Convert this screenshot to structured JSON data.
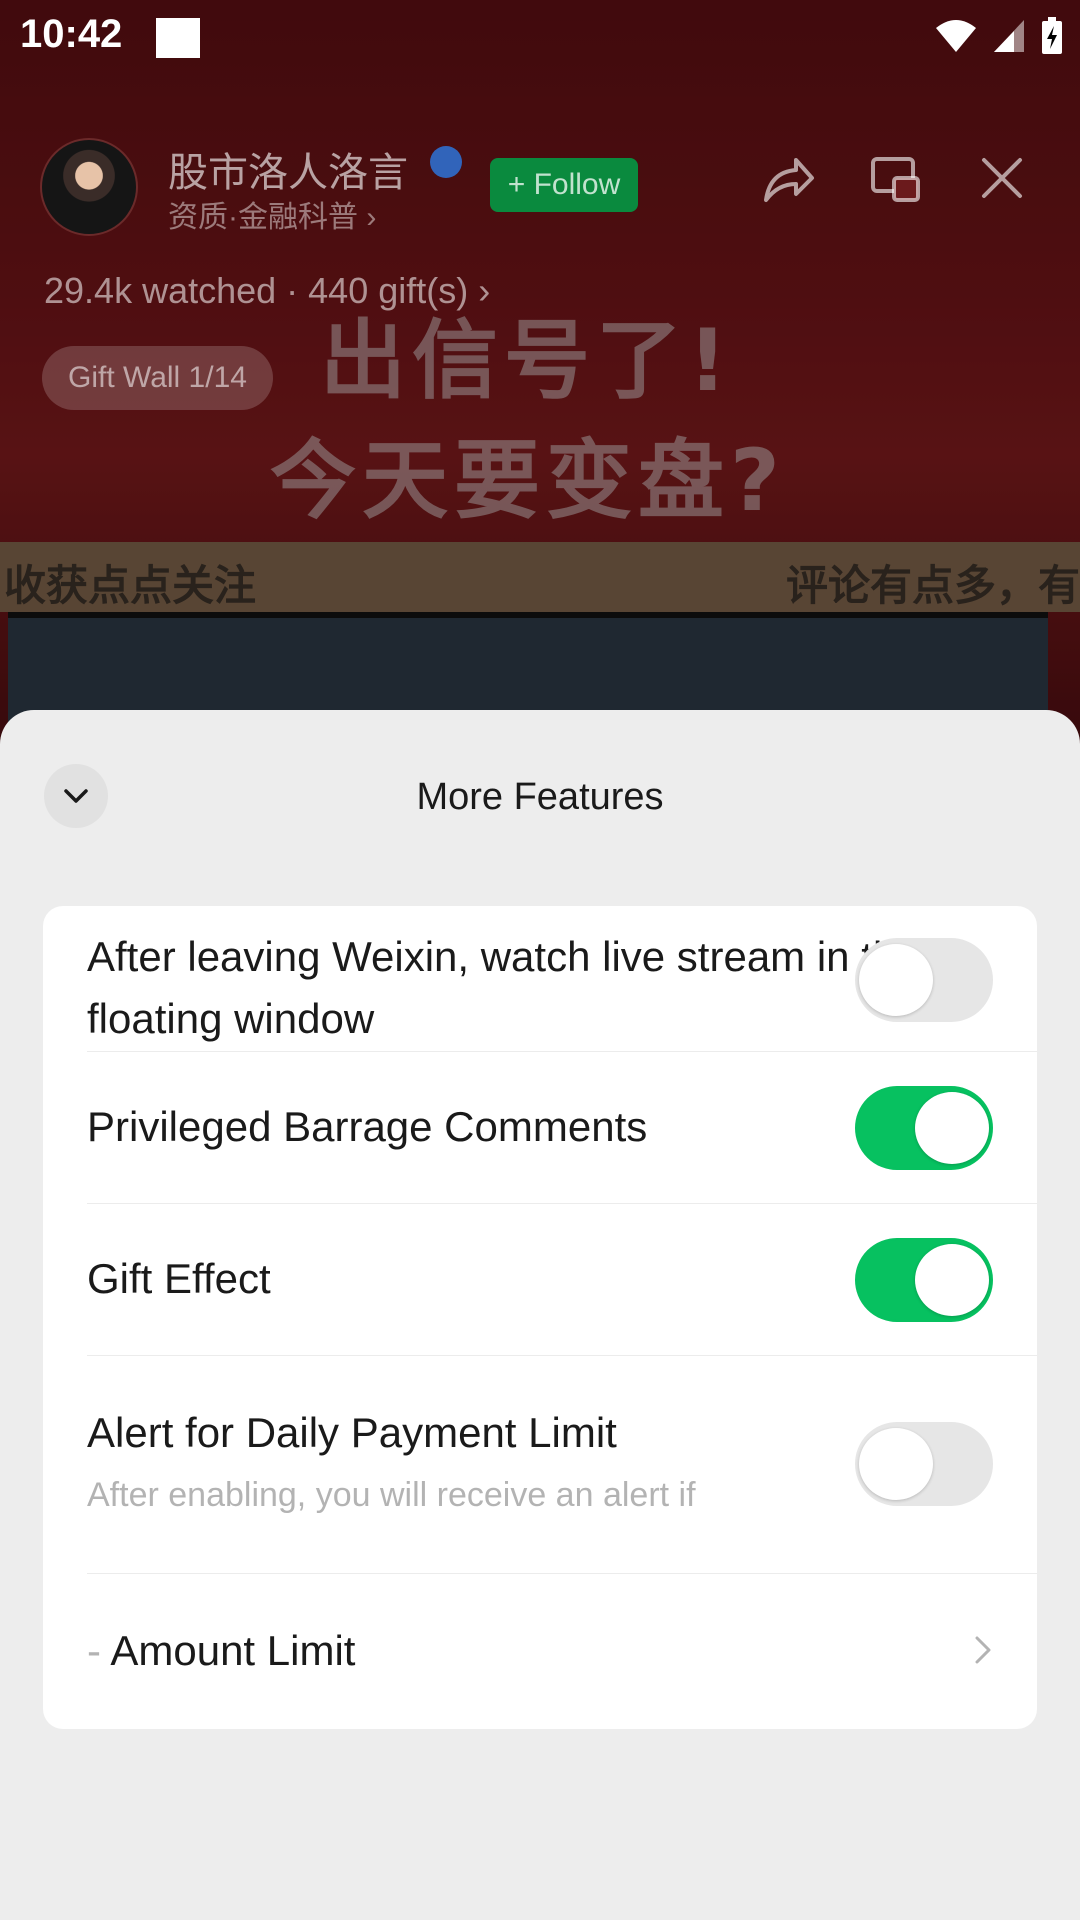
{
  "status_bar": {
    "time": "10:42"
  },
  "stream": {
    "host_name": "股市洛人洛言",
    "host_cert": "资质·金融科普 ›",
    "follow_label": "+ Follow",
    "watched": "29.4k watched · 440 gift(s) ›",
    "gift_wall": "Gift Wall 1/14",
    "headline_1": "出信号了!",
    "headline_2": "今天要变盘?",
    "ticker_left": "收获点点关注",
    "ticker_right": "评论有点多，有"
  },
  "sheet": {
    "title": "More Features",
    "items": [
      {
        "label": "After leaving Weixin, watch live stream in the floating window",
        "toggle": "off"
      },
      {
        "label": "Privileged Barrage Comments",
        "toggle": "on"
      },
      {
        "label": "Gift Effect",
        "toggle": "on"
      },
      {
        "label": "Alert for Daily Payment Limit",
        "subtitle": "After enabling, you will receive an alert if",
        "toggle": "off"
      },
      {
        "label": "Amount Limit",
        "prefix": "-"
      }
    ]
  },
  "colors": {
    "toggle_on": "#07c160",
    "follow_green": "#0a8a3e"
  }
}
